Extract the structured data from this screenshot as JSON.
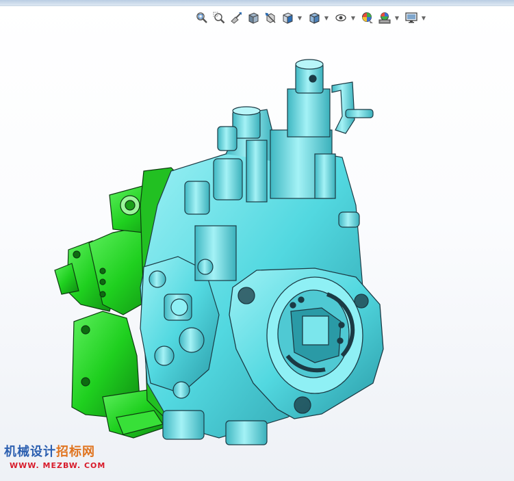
{
  "toolbar": {
    "items": [
      {
        "icon": "zoom-to-fit-icon"
      },
      {
        "icon": "zoom-to-area-icon"
      },
      {
        "icon": "previous-view-icon"
      },
      {
        "icon": "section-view-icon"
      },
      {
        "icon": "dynamic-annotation-icon"
      },
      {
        "icon": "view-orientation-icon",
        "dropdown": true
      },
      {
        "icon": "display-style-icon",
        "dropdown": true
      },
      {
        "icon": "hide-show-items-icon",
        "dropdown": true
      },
      {
        "icon": "edit-appearance-icon"
      },
      {
        "icon": "apply-scene-icon",
        "dropdown": true
      },
      {
        "icon": "view-settings-icon",
        "dropdown": true
      }
    ]
  },
  "colors": {
    "part_cyan": "#52d8e0",
    "part_cyan_dark": "#2a9aa6",
    "part_green": "#1fd01f",
    "part_green_dark": "#0f8a12",
    "edge": "#1b3a44"
  },
  "watermark": {
    "line1_a": "机械设计",
    "line1_b": "招标网",
    "line2": "WWW. MEZBW. COM"
  }
}
